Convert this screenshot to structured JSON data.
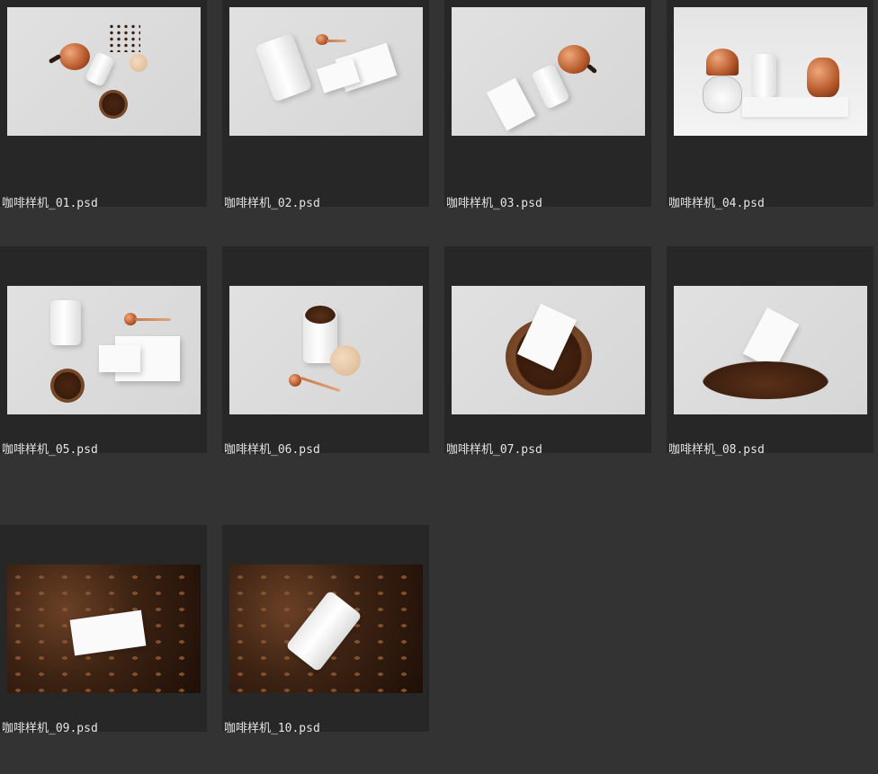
{
  "files": [
    {
      "name": "咖啡样机_01.psd",
      "icon": "image-thumbnail-icon",
      "scene": "kettle-canister-beans"
    },
    {
      "name": "咖啡样机_02.psd",
      "icon": "image-thumbnail-icon",
      "scene": "canister-scoop-cards"
    },
    {
      "name": "咖啡样机_03.psd",
      "icon": "image-thumbnail-icon",
      "scene": "kettle-card-canister"
    },
    {
      "name": "咖啡样机_04.psd",
      "icon": "image-thumbnail-icon",
      "scene": "dripper-canister-kettle"
    },
    {
      "name": "咖啡样机_05.psd",
      "icon": "image-thumbnail-icon",
      "scene": "canister-scoop-cards-beans"
    },
    {
      "name": "咖啡样机_06.psd",
      "icon": "image-thumbnail-icon",
      "scene": "open-canister-lid-scoop"
    },
    {
      "name": "咖啡样机_07.psd",
      "icon": "image-thumbnail-icon",
      "scene": "card-in-bean-bowl"
    },
    {
      "name": "咖啡样机_08.psd",
      "icon": "image-thumbnail-icon",
      "scene": "card-on-bean-pile"
    },
    {
      "name": "咖啡样机_09.psd",
      "icon": "image-thumbnail-icon",
      "scene": "card-in-beans"
    },
    {
      "name": "咖啡样机_10.psd",
      "icon": "image-thumbnail-icon",
      "scene": "canister-in-beans"
    }
  ],
  "colors": {
    "background": "#333333",
    "tile": "#272727",
    "label_text": "#e6e6e6",
    "copper": "#b5582c",
    "coffee_bean": "#3d1f0f"
  }
}
